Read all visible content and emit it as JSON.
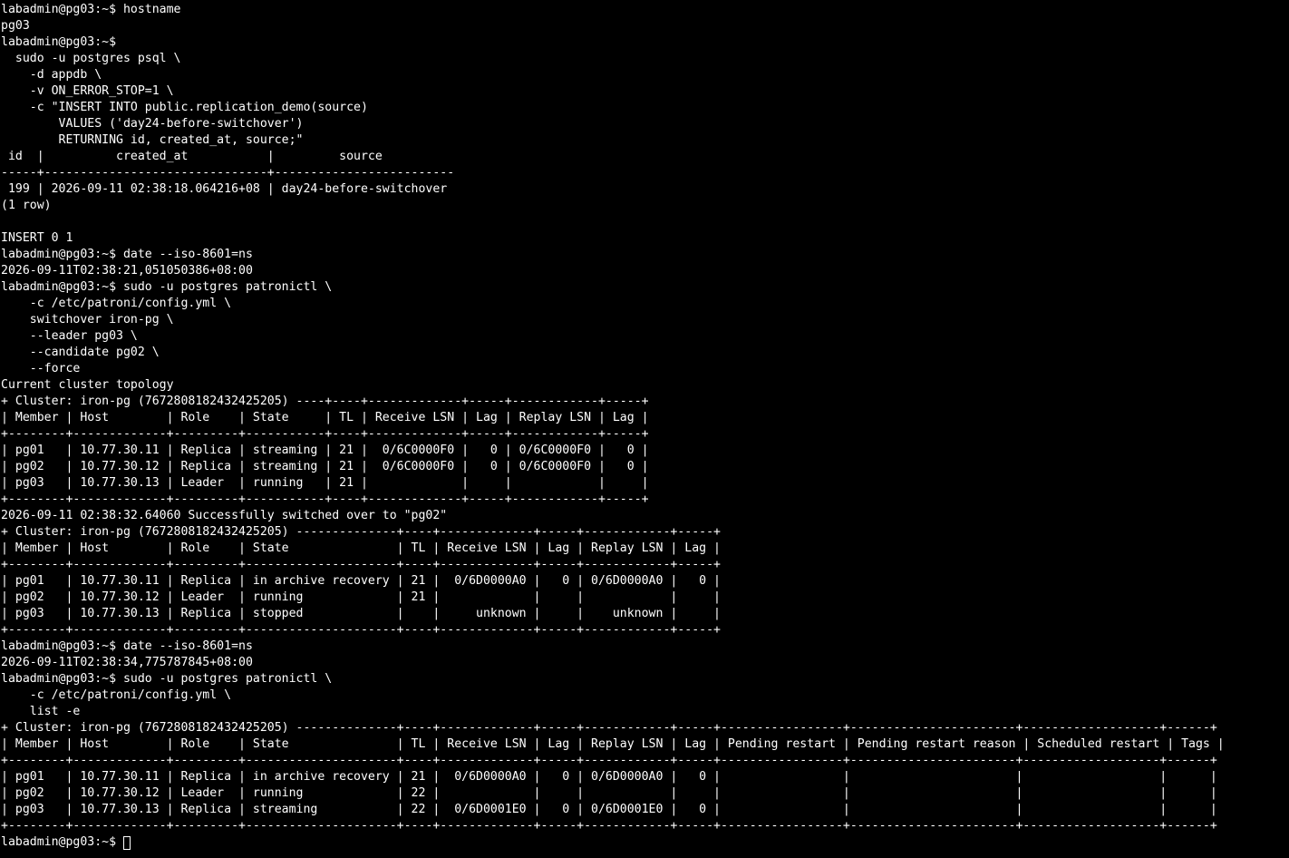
{
  "terminal": {
    "lines": [
      "labadmin@pg03:~$ hostname",
      "pg03",
      "labadmin@pg03:~$",
      "  sudo -u postgres psql \\",
      "    -d appdb \\",
      "    -v ON_ERROR_STOP=1 \\",
      "    -c \"INSERT INTO public.replication_demo(source)",
      "        VALUES ('day24-before-switchover')",
      "        RETURNING id, created_at, source;\"",
      " id  |          created_at           |         source",
      "-----+-------------------------------+-------------------------",
      " 199 | 2026-09-11 02:38:18.064216+08 | day24-before-switchover",
      "(1 row)",
      "",
      "INSERT 0 1",
      "labadmin@pg03:~$ date --iso-8601=ns",
      "2026-09-11T02:38:21,051050386+08:00",
      "labadmin@pg03:~$ sudo -u postgres patronictl \\",
      "    -c /etc/patroni/config.yml \\",
      "    switchover iron-pg \\",
      "    --leader pg03 \\",
      "    --candidate pg02 \\",
      "    --force",
      "Current cluster topology",
      "+ Cluster: iron-pg (7672808182432425205) ----+----+-------------+-----+------------+-----+",
      "| Member | Host        | Role    | State     | TL | Receive LSN | Lag | Replay LSN | Lag |",
      "+--------+-------------+---------+-----------+----+-------------+-----+------------+-----+",
      "| pg01   | 10.77.30.11 | Replica | streaming | 21 |  0/6C0000F0 |   0 | 0/6C0000F0 |   0 |",
      "| pg02   | 10.77.30.12 | Replica | streaming | 21 |  0/6C0000F0 |   0 | 0/6C0000F0 |   0 |",
      "| pg03   | 10.77.30.13 | Leader  | running   | 21 |             |     |            |     |",
      "+--------+-------------+---------+-----------+----+-------------+-----+------------+-----+",
      "2026-09-11 02:38:32.64060 Successfully switched over to \"pg02\"",
      "+ Cluster: iron-pg (7672808182432425205) --------------+----+-------------+-----+------------+-----+",
      "| Member | Host        | Role    | State               | TL | Receive LSN | Lag | Replay LSN | Lag |",
      "+--------+-------------+---------+---------------------+----+-------------+-----+------------+-----+",
      "| pg01   | 10.77.30.11 | Replica | in archive recovery | 21 |  0/6D0000A0 |   0 | 0/6D0000A0 |   0 |",
      "| pg02   | 10.77.30.12 | Leader  | running             | 21 |             |     |            |     |",
      "| pg03   | 10.77.30.13 | Replica | stopped             |    |     unknown |     |    unknown |     |",
      "+--------+-------------+---------+---------------------+----+-------------+-----+------------+-----+",
      "labadmin@pg03:~$ date --iso-8601=ns",
      "2026-09-11T02:38:34,775787845+08:00",
      "labadmin@pg03:~$ sudo -u postgres patronictl \\",
      "    -c /etc/patroni/config.yml \\",
      "    list -e",
      "+ Cluster: iron-pg (7672808182432425205) --------------+----+-------------+-----+------------+-----+-----------------+-----------------------+-------------------+------+",
      "| Member | Host        | Role    | State               | TL | Receive LSN | Lag | Replay LSN | Lag | Pending restart | Pending restart reason | Scheduled restart | Tags |",
      "+--------+-------------+---------+---------------------+----+-------------+-----+------------+-----+-----------------+-----------------------+-------------------+------+",
      "| pg01   | 10.77.30.11 | Replica | in archive recovery | 21 |  0/6D0000A0 |   0 | 0/6D0000A0 |   0 |                 |                       |                   |      |",
      "| pg02   | 10.77.30.12 | Leader  | running             | 22 |             |     |            |     |                 |                       |                   |      |",
      "| pg03   | 10.77.30.13 | Replica | streaming           | 22 |  0/6D0001E0 |   0 | 0/6D0001E0 |   0 |                 |                       |                   |      |",
      "+--------+-------------+---------+---------------------+----+-------------+-----+------------+-----+-----------------+-----------------------+-------------------+------+"
    ],
    "prompt": "labadmin@pg03:~$ ",
    "colors": {
      "background": "#000000",
      "foreground": "#ffffff"
    }
  }
}
